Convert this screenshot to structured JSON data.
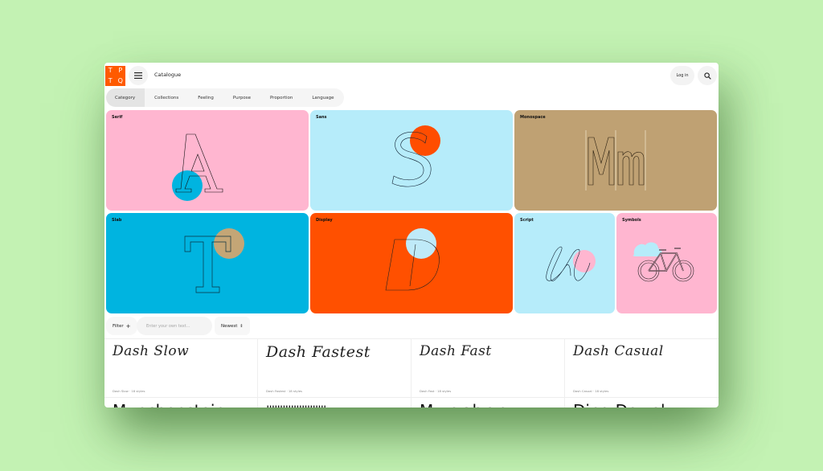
{
  "header": {
    "logo_letters": [
      "T",
      "P",
      "T",
      "Q"
    ],
    "menu_icon": "hamburger-icon",
    "title": "Catalogue",
    "login_label": "Log in",
    "search_icon": "search-icon"
  },
  "tabs": [
    {
      "label": "Category",
      "active": true
    },
    {
      "label": "Collections",
      "active": false
    },
    {
      "label": "Feeling",
      "active": false
    },
    {
      "label": "Purpose",
      "active": false
    },
    {
      "label": "Proportion",
      "active": false
    },
    {
      "label": "Language",
      "active": false
    }
  ],
  "categories": [
    {
      "label": "Serif",
      "glyph": "A",
      "bg": "#ffb6d0",
      "dot": "#00b4e0"
    },
    {
      "label": "Sans",
      "glyph": "S",
      "bg": "#b6ecfa",
      "dot": "#ff4d00"
    },
    {
      "label": "Monospace",
      "glyph": "Mm",
      "bg": "#bfa173",
      "dot": ""
    },
    {
      "label": "Slab",
      "glyph": "T",
      "bg": "#00b4e0",
      "dot": "#c4a676"
    },
    {
      "label": "Display",
      "glyph": "D",
      "bg": "#ff5000",
      "dot": "#bfeaf8"
    },
    {
      "label": "Script",
      "glyph": "u",
      "bg": "#b6ecfa",
      "dot": "#ffb6d0"
    },
    {
      "label": "Symbols",
      "glyph": "bicycle-icon",
      "bg": "#ffb6d0",
      "dot": "#b6ecfa"
    }
  ],
  "filters": {
    "filter_label": "Filter",
    "filter_icon": "plus-icon",
    "text_placeholder": "Enter your own text...",
    "sort_label": "Newest",
    "sort_icon": "sort-arrows-icon"
  },
  "fonts": [
    {
      "name": "Dash Slow",
      "sample": "Dash Slow",
      "meta": "Dash Slow · 18 styles"
    },
    {
      "name": "Dash Fastest",
      "sample": "Dash Fastest",
      "meta": "Dash Fastest · 18 styles"
    },
    {
      "name": "Dash Fast",
      "sample": "Dash Fast",
      "meta": "Dash Fast · 18 styles"
    },
    {
      "name": "Dash Casual",
      "sample": "Dash Casual",
      "meta": "Dash Casual · 18 styles"
    }
  ],
  "fonts_row2": [
    {
      "sample": "Munchenstein"
    },
    {
      "sample": "||||||||||||||||||||||"
    },
    {
      "sample": "Munchenz"
    },
    {
      "sample": "Ding Dowel"
    }
  ]
}
